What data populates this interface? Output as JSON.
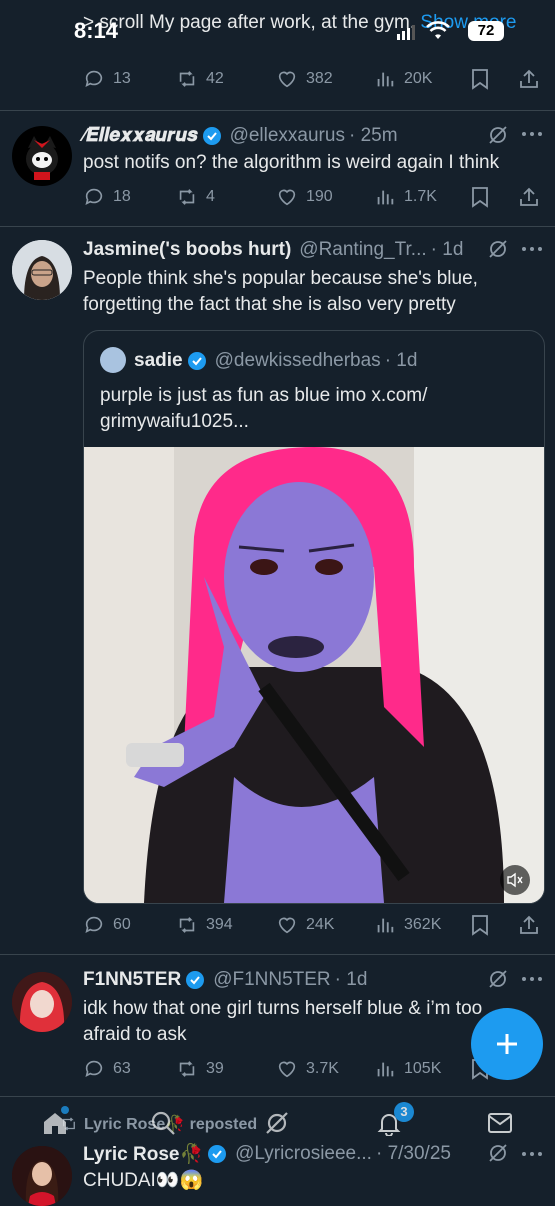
{
  "status_bar": {
    "time": "8:14",
    "battery": "72"
  },
  "tweet0": {
    "text_tail": "> scroll My page after work, at the gym.",
    "show_more": "Show more",
    "actions": {
      "replies": "13",
      "reposts": "42",
      "likes": "382",
      "views": "20K"
    }
  },
  "tweet1": {
    "display_name": "∕𝑬𝒍𝒍𝒆𝒙𝒙𝒂𝒖𝒓𝒖𝒔",
    "handle": "@ellexxaurus",
    "time": "· 25m",
    "text": "post notifs on? the algorithm is weird again I think",
    "actions": {
      "replies": "18",
      "reposts": "4",
      "likes": "190",
      "views": "1.7K"
    }
  },
  "tweet2": {
    "display_name": "Jasmine('s boobs hurt)",
    "handle": "@Ranting_Tr...",
    "time": "· 1d",
    "text": "People think she's popular because she's blue, forgetting the fact that she is also very pretty",
    "quote": {
      "display_name": "sadie",
      "handle": "@dewkissedherbas",
      "time": "· 1d",
      "text": "purple is just as fun as blue imo x.com/ grimywaifu1025..."
    },
    "actions": {
      "replies": "60",
      "reposts": "394",
      "likes": "24K",
      "views": "362K"
    }
  },
  "tweet3": {
    "display_name": "F1NN5TER",
    "handle": "@F1NN5TER",
    "time": "· 1d",
    "text": "idk how that one girl turns herself blue & i’m too afraid to ask",
    "actions": {
      "replies": "63",
      "reposts": "39",
      "likes": "3.7K",
      "views": "105K"
    }
  },
  "tweet4": {
    "repost_label": "Lyric Rose🥀 reposted",
    "display_name": "Lyric Rose🥀",
    "handle": "@Lyricrosieee...",
    "time": "· 7/30/25",
    "text": "CHUDAI👀😱"
  },
  "tabbar": {
    "notifications_badge": "3"
  },
  "colors": {
    "background": "#15202b",
    "accent": "#1d9bf0",
    "muted": "#8b98a5",
    "divider": "#38444d"
  }
}
